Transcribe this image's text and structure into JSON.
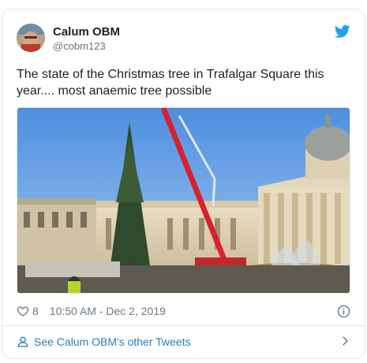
{
  "tweet": {
    "author_name": "Calum OBM",
    "author_handle": "@cobm123",
    "text": "The state of the Christmas tree in Trafalgar Square this year.... most anaemic tree possible",
    "like_count": "8",
    "timestamp": "10:50 AM - Dec 2, 2019"
  },
  "footer": {
    "link_label": "See Calum OBM's other Tweets"
  },
  "icons": {
    "brand": "twitter-bird-icon",
    "like": "heart-icon",
    "info": "info-icon",
    "profile": "person-icon",
    "chevron": "chevron-right-icon"
  },
  "colors": {
    "twitter_blue": "#1da1f2",
    "link_blue": "#2b7bb9",
    "muted": "#697882",
    "border": "#e1e8ed"
  }
}
